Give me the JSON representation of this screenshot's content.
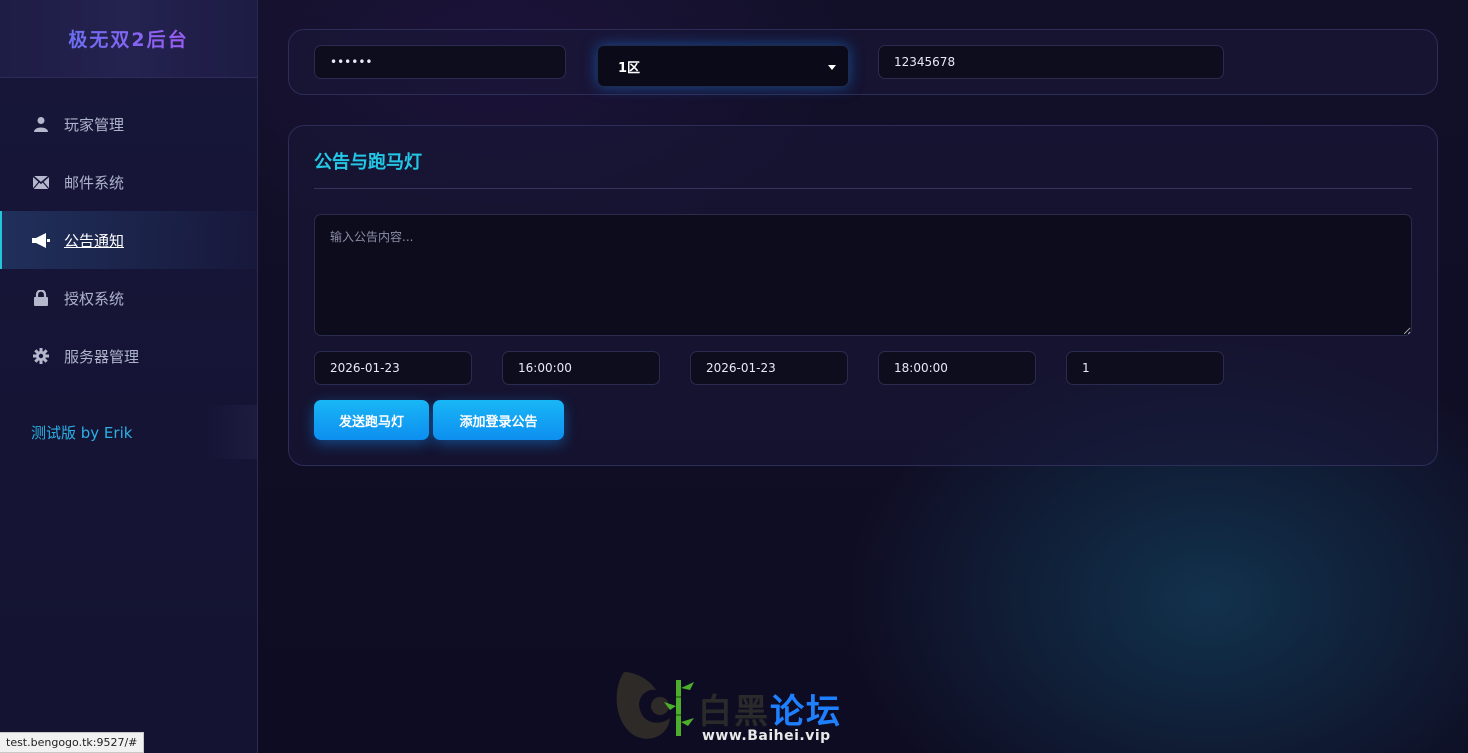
{
  "app": {
    "title": "极无双2后台"
  },
  "sidebar": {
    "items": [
      {
        "label": "玩家管理",
        "icon": "user-icon"
      },
      {
        "label": "邮件系统",
        "icon": "mail-icon"
      },
      {
        "label": "公告通知",
        "icon": "megaphone-icon",
        "active": true
      },
      {
        "label": "授权系统",
        "icon": "lock-icon"
      },
      {
        "label": "服务器管理",
        "icon": "gear-icon"
      }
    ],
    "version": "测试版 by Erik"
  },
  "toolbar": {
    "password_value": "••••••",
    "server_select": "1区",
    "account_value": "12345678"
  },
  "announcement": {
    "title": "公告与跑马灯",
    "content_placeholder": "输入公告内容...",
    "start_date": "2026-01-23",
    "start_time": "16:00:00",
    "end_date": "2026-01-23",
    "end_time": "18:00:00",
    "interval": "1",
    "send_marquee_label": "发送跑马灯",
    "add_login_notice_label": "添加登录公告"
  },
  "watermark": {
    "text_dark": "白黑",
    "text_blue": "论坛",
    "url": "www.Baihei.vip"
  },
  "status_bar": {
    "url": "test.bengogo.tk:9527/#"
  },
  "colors": {
    "accent": "#22c8e6",
    "button": "#19b7f6",
    "background": "#0d0c1f",
    "sidebar": "#17163a"
  }
}
